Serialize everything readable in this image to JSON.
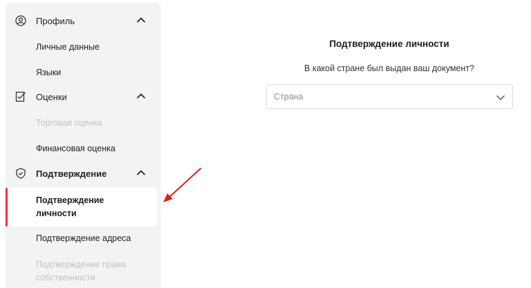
{
  "sidebar": {
    "profile": {
      "label": "Профиль",
      "icon": "user-circle-icon",
      "items": [
        {
          "label": "Личные данные",
          "state": "normal"
        },
        {
          "label": "Языки",
          "state": "normal"
        }
      ]
    },
    "ratings": {
      "label": "Оценки",
      "icon": "checklist-icon",
      "items": [
        {
          "label": "Торговая оценка",
          "state": "disabled"
        },
        {
          "label": "Финансовая оценка",
          "state": "normal"
        }
      ]
    },
    "verification": {
      "label": "Подтверждение",
      "icon": "shield-check-icon",
      "items": [
        {
          "label_line1": "Подтверждение",
          "label_line2": "личности",
          "state": "active"
        },
        {
          "label": "Подтверждение адреса",
          "state": "normal"
        },
        {
          "label_line1": "Подтверждение права",
          "label_line2": "собственности",
          "state": "disabled"
        }
      ]
    }
  },
  "main": {
    "title": "Подтверждение личности",
    "question": "В какой стране был выдан ваш документ?",
    "country_select": {
      "placeholder": "Страна"
    }
  },
  "colors": {
    "accent": "#e8343a",
    "sidebar_bg": "#f3f3f3",
    "disabled_text": "#c3c3c3",
    "annotation_arrow": "#e02020"
  }
}
